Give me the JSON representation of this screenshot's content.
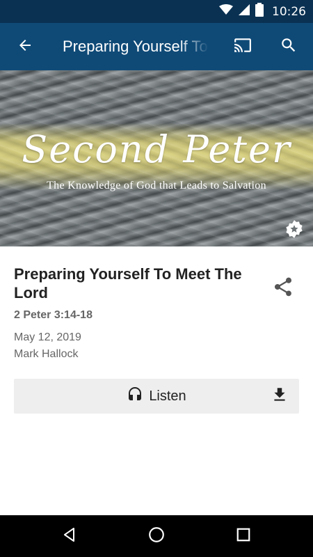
{
  "status_bar": {
    "time": "10:26",
    "icons": [
      "wifi-icon",
      "signal-icon",
      "battery-icon"
    ],
    "background": "#0a3152"
  },
  "app_bar": {
    "title": "Preparing Yourself To Meet The Lord",
    "background": "#0f4a77",
    "icons": [
      "back-arrow-icon",
      "cast-icon",
      "search-icon"
    ]
  },
  "hero": {
    "title": "Second Peter",
    "subtitle": "The Knowledge of God that Leads to Salvation",
    "favorite_icon": "star-badge-icon"
  },
  "sermon": {
    "title": "Preparing Yourself To Meet The Lord",
    "scripture": "2 Peter 3:14-18",
    "date": "May 12, 2019",
    "speaker": "Mark Hallock",
    "share_icon": "share-icon"
  },
  "actions": {
    "listen_label": "Listen",
    "listen_icon": "headphones-icon",
    "download_icon": "download-icon"
  },
  "nav_bar": {
    "icons": [
      "back-triangle-icon",
      "home-circle-icon",
      "recents-square-icon"
    ]
  }
}
